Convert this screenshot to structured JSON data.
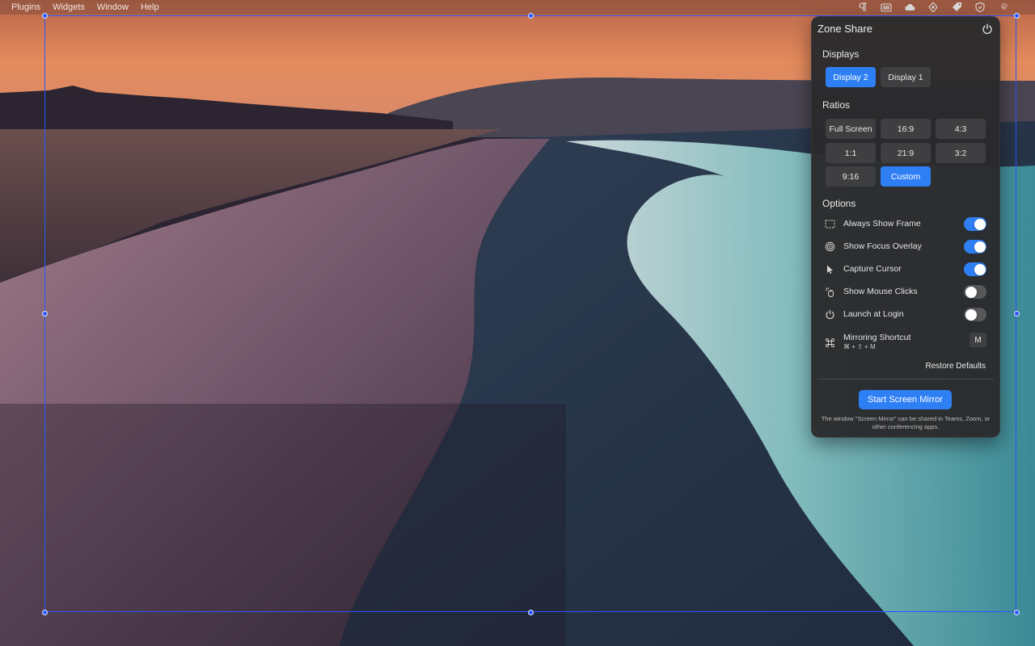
{
  "menubar": {
    "items": [
      "Plugins",
      "Widgets",
      "Window",
      "Help"
    ],
    "status_icons": [
      "paragraph-icon",
      "window-icon",
      "cloud-icon",
      "location-icon",
      "tag-icon",
      "shield-icon",
      "spiral-icon"
    ]
  },
  "panel": {
    "title": "Zone Share",
    "displays": {
      "label": "Displays",
      "options": [
        "Display 2",
        "Display 1"
      ],
      "selected": "Display 2"
    },
    "ratios": {
      "label": "Ratios",
      "options": [
        "Full Screen",
        "16:9",
        "4:3",
        "1:1",
        "21:9",
        "3:2",
        "9:16",
        "Custom"
      ],
      "selected": "Custom"
    },
    "options": {
      "label": "Options",
      "items": [
        {
          "label": "Always Show Frame",
          "icon": "dashed-frame-icon",
          "on": true
        },
        {
          "label": "Show Focus Overlay",
          "icon": "target-icon",
          "on": true
        },
        {
          "label": "Capture Cursor",
          "icon": "cursor-icon",
          "on": true
        },
        {
          "label": "Show Mouse Clicks",
          "icon": "mouse-click-icon",
          "on": false
        },
        {
          "label": "Launch at Login",
          "icon": "power-icon",
          "on": false
        }
      ],
      "shortcut": {
        "label": "Mirroring Shortcut",
        "combo": "⌘ + ⇧ + M",
        "key": "M",
        "icon": "command-icon"
      }
    },
    "restore_label": "Restore Defaults",
    "start_label": "Start Screen Mirror",
    "footnote": "The window \"Screen Mirror\" can be shared in Teams, Zoom, or other conferencing apps."
  },
  "colors": {
    "accent": "#2f7ff4",
    "frame": "#2b56ff",
    "panel_bg": "#2a2a2c"
  }
}
